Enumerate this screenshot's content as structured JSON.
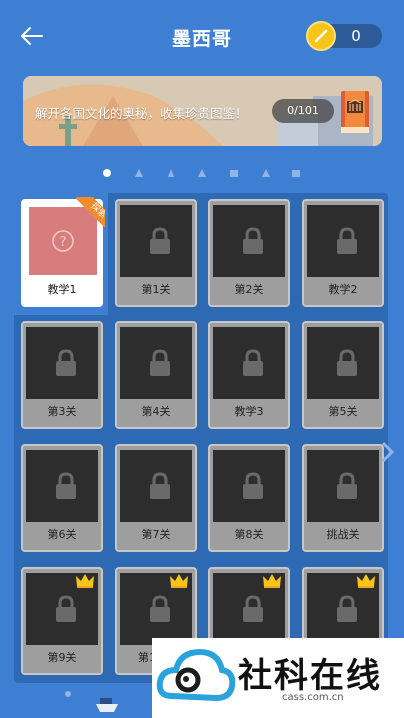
{
  "header": {
    "title": "墨西哥",
    "coins": "0"
  },
  "banner": {
    "text": "解开各国文化的奥秘，收集珍贵图鉴！",
    "progress": "0/101"
  },
  "pagination": {
    "total": 7,
    "active": 0
  },
  "levels": [
    {
      "label": "教学1",
      "state": "active",
      "badge": "探索",
      "icon": "question-icon"
    },
    {
      "label": "第1关",
      "state": "locked"
    },
    {
      "label": "第2关",
      "state": "locked"
    },
    {
      "label": "教学2",
      "state": "locked"
    },
    {
      "label": "第3关",
      "state": "locked"
    },
    {
      "label": "第4关",
      "state": "locked"
    },
    {
      "label": "教学3",
      "state": "locked"
    },
    {
      "label": "第5关",
      "state": "locked"
    },
    {
      "label": "第6关",
      "state": "locked"
    },
    {
      "label": "第7关",
      "state": "locked"
    },
    {
      "label": "第8关",
      "state": "locked"
    },
    {
      "label": "挑战关",
      "state": "locked"
    },
    {
      "label": "第9关",
      "state": "locked",
      "crown": true
    },
    {
      "label": "第10关",
      "state": "locked",
      "crown": true
    },
    {
      "label": "",
      "state": "locked",
      "crown": true
    },
    {
      "label": "",
      "state": "locked",
      "crown": true
    }
  ],
  "watermark": {
    "brand": "社科在线",
    "url": "cass.com.cn"
  },
  "colors": {
    "background": "#3f7fd3",
    "grid": "#2e6ab4",
    "coin": "#f7c51a",
    "badge": "#f08c2a"
  }
}
